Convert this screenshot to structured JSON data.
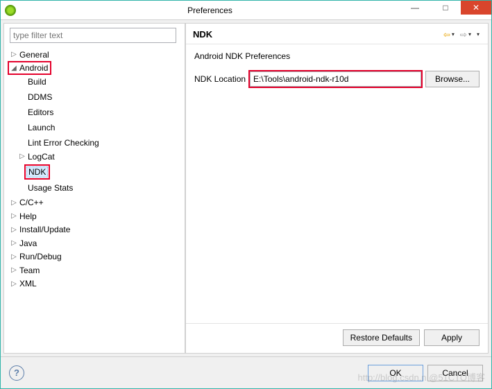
{
  "window": {
    "title": "Preferences",
    "min_label": "—",
    "max_label": "□",
    "close_label": "✕"
  },
  "filter": {
    "placeholder": "type filter text"
  },
  "tree": {
    "nodes": {
      "general": "General",
      "android": "Android",
      "build": "Build",
      "ddms": "DDMS",
      "editors": "Editors",
      "launch": "Launch",
      "lint": "Lint Error Checking",
      "logcat": "LogCat",
      "ndk": "NDK",
      "usage": "Usage Stats",
      "ccpp": "C/C++",
      "help": "Help",
      "install": "Install/Update",
      "java": "Java",
      "run": "Run/Debug",
      "team": "Team",
      "xml": "XML"
    }
  },
  "page": {
    "title": "NDK",
    "subtitle": "Android NDK Preferences",
    "ndk_location_label": "NDK Location",
    "ndk_location_value": "E:\\Tools\\android-ndk-r10d",
    "browse_label": "Browse..."
  },
  "buttons": {
    "restore": "Restore Defaults",
    "apply": "Apply",
    "ok": "OK",
    "cancel": "Cancel"
  },
  "watermark": "http://blog.csdn.n @51CTO博客"
}
